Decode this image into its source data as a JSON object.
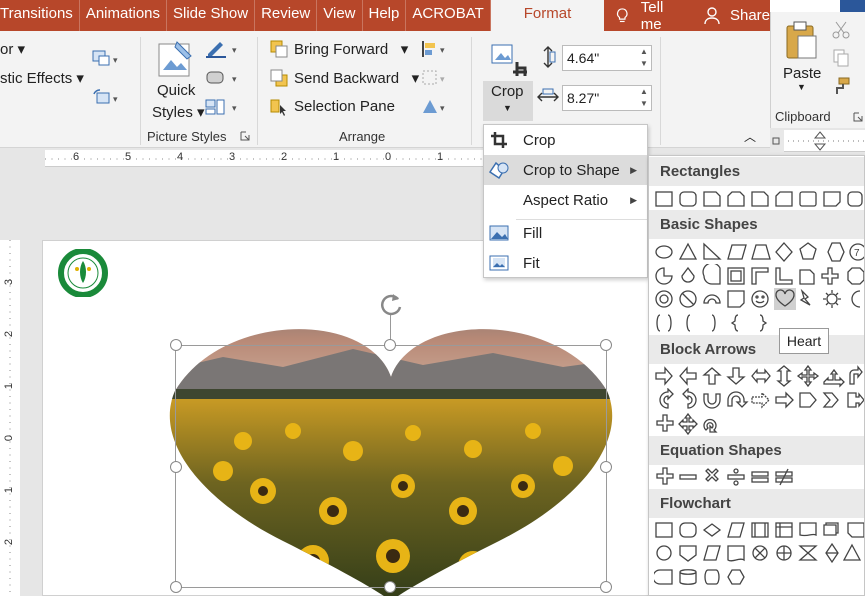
{
  "tabs": [
    "Transitions",
    "Animations",
    "Slide Show",
    "Review",
    "View",
    "Help",
    "ACROBAT",
    "Format"
  ],
  "tell_me": "Tell me",
  "share": "Share",
  "ribbon": {
    "color_label": "or",
    "artistic_effects": "stic Effects",
    "quick_styles_line1": "Quick",
    "quick_styles_line2": "Styles",
    "bring_forward": "Bring Forward",
    "send_backward": "Send Backward",
    "selection_pane": "Selection Pane",
    "crop_label": "Crop",
    "height_value": "4.64\"",
    "width_value": "8.27\"",
    "group_picture_styles": "Picture Styles",
    "group_arrange": "Arrange"
  },
  "clipboard": {
    "paste": "Paste",
    "group_label": "Clipboard"
  },
  "crop_menu": {
    "items": [
      {
        "label": "Crop"
      },
      {
        "label": "Crop to Shape"
      },
      {
        "label": "Aspect Ratio"
      },
      {
        "label": "Fill"
      },
      {
        "label": "Fit"
      }
    ]
  },
  "gallery": {
    "sections": [
      "Rectangles",
      "Basic Shapes",
      "Block Arrows",
      "Equation Shapes",
      "Flowchart"
    ],
    "tooltip": "Heart"
  },
  "ruler": {
    "h_labels": [
      "6",
      "5",
      "4",
      "3",
      "2",
      "1",
      "0",
      "1"
    ],
    "v_labels": [
      "3",
      "2",
      "1",
      "0",
      "1",
      "2"
    ]
  },
  "colors": {
    "accent": "#b7472a",
    "ribbon_bg": "#f3f3f3",
    "gallery_header": "#eaeaea"
  }
}
